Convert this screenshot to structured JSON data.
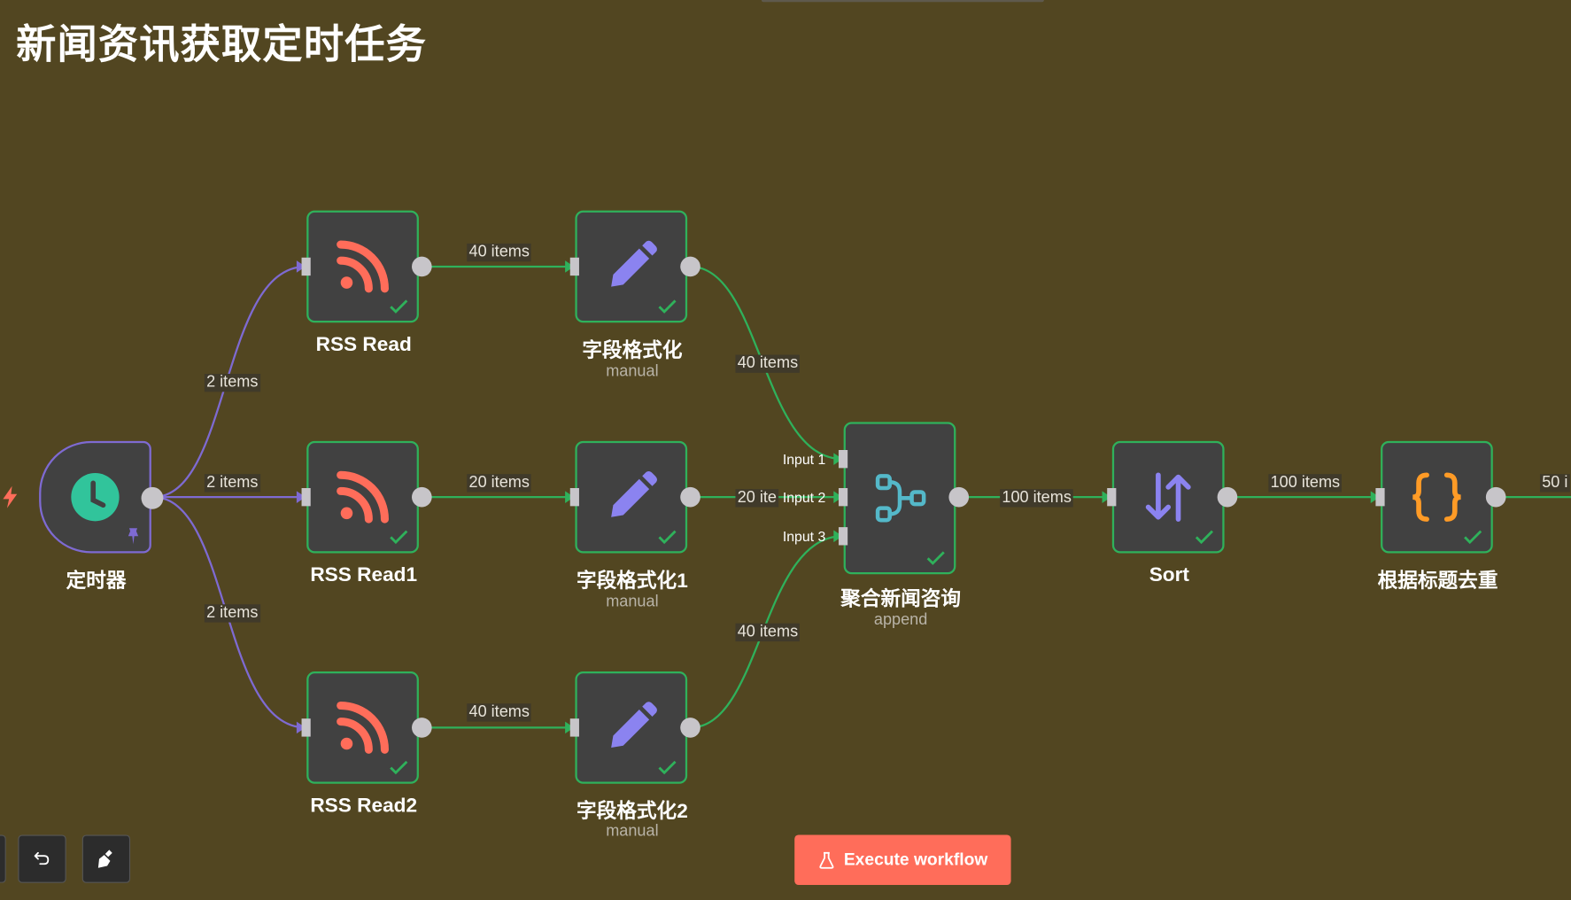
{
  "workflow": {
    "title": "新闻资讯获取定时任务"
  },
  "nodes": {
    "trigger": {
      "name": "定时器",
      "icon": "clock-icon",
      "pinned": true
    },
    "rss0": {
      "name": "RSS Read",
      "icon": "rss-icon",
      "status": "success"
    },
    "rss1": {
      "name": "RSS Read1",
      "icon": "rss-icon",
      "status": "success"
    },
    "rss2": {
      "name": "RSS Read2",
      "icon": "rss-icon",
      "status": "success"
    },
    "fmt0": {
      "name": "字段格式化",
      "subtitle": "manual",
      "icon": "pencil-icon",
      "status": "success"
    },
    "fmt1": {
      "name": "字段格式化1",
      "subtitle": "manual",
      "icon": "pencil-icon",
      "status": "success"
    },
    "fmt2": {
      "name": "字段格式化2",
      "subtitle": "manual",
      "icon": "pencil-icon",
      "status": "success"
    },
    "merge": {
      "name": "聚合新闻咨询",
      "subtitle": "append",
      "icon": "merge-icon",
      "status": "success",
      "inputs": [
        "Input 1",
        "Input 2",
        "Input 3"
      ]
    },
    "sort": {
      "name": "Sort",
      "icon": "sort-icon",
      "status": "success"
    },
    "dedupe": {
      "name": "根据标题去重",
      "icon": "code-braces-icon",
      "status": "success"
    }
  },
  "edges": {
    "trigger_rss0": "2 items",
    "trigger_rss1": "2 items",
    "trigger_rss2": "2 items",
    "rss0_fmt0": "40 items",
    "rss1_fmt1": "20 items",
    "rss2_fmt2": "40 items",
    "fmt0_merge": "40 items",
    "fmt1_merge": "20 ite",
    "fmt2_merge": "40 items",
    "merge_sort": "100 items",
    "sort_dedupe": "100 items",
    "dedupe_next": "50 i"
  },
  "toolbar": {
    "execute_label": "Execute workflow",
    "undo_icon": "undo-icon",
    "tidy_icon": "broom-icon"
  },
  "colors": {
    "canvas": "#524621",
    "node_bg": "#414141",
    "success": "#2fb15b",
    "trigger_edge": "#7e6ad2",
    "rss": "#ff6d5a",
    "pencil": "#8b83f0",
    "merge": "#54b8c9",
    "code": "#ff9b26",
    "execute": "#ff6d5a"
  }
}
